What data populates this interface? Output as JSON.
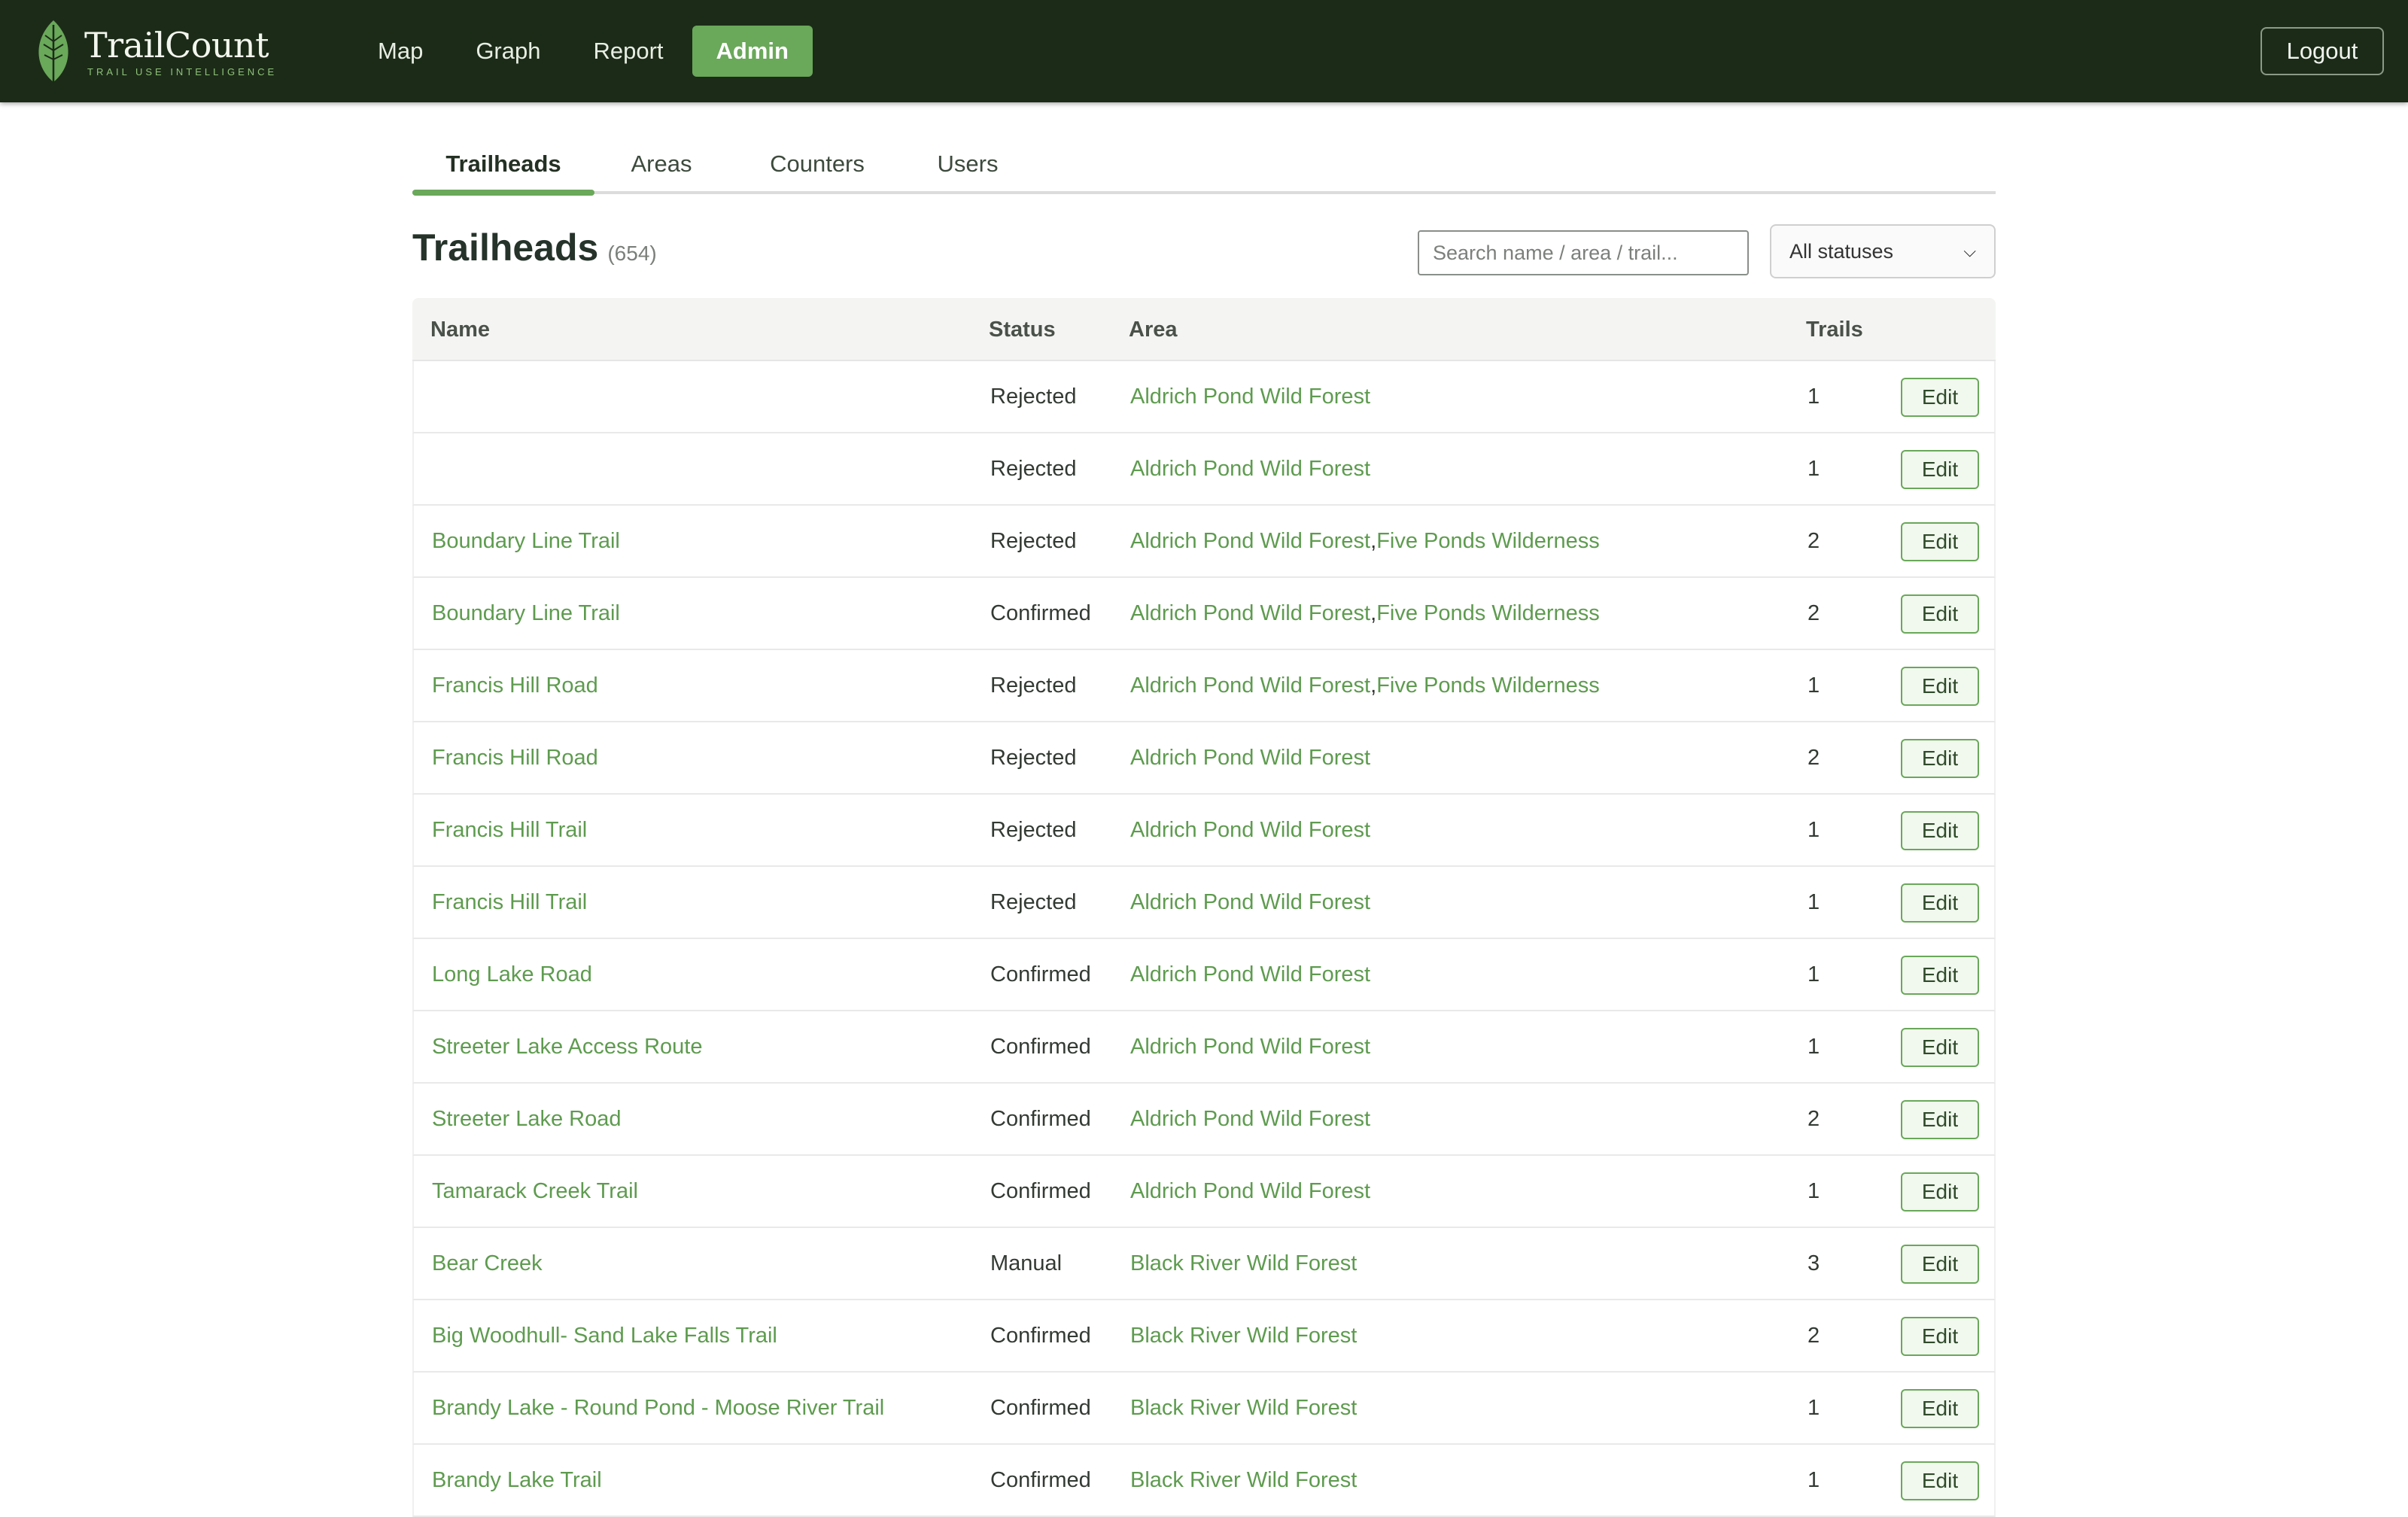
{
  "brand": {
    "name": "TrailCount",
    "tagline": "TRAIL USE INTELLIGENCE"
  },
  "nav": {
    "items": [
      {
        "label": "Map",
        "active": false
      },
      {
        "label": "Graph",
        "active": false
      },
      {
        "label": "Report",
        "active": false
      },
      {
        "label": "Admin",
        "active": true
      }
    ],
    "logout_label": "Logout"
  },
  "subtabs": [
    {
      "label": "Trailheads",
      "active": true
    },
    {
      "label": "Areas",
      "active": false
    },
    {
      "label": "Counters",
      "active": false
    },
    {
      "label": "Users",
      "active": false
    }
  ],
  "page": {
    "title": "Trailheads",
    "count": "(654)",
    "search_placeholder": "Search name / area / trail...",
    "status_filter": "All statuses"
  },
  "table": {
    "columns": [
      "Name",
      "Status",
      "Area",
      "Trails"
    ],
    "edit_label": "Edit",
    "rows": [
      {
        "name": "",
        "status": "Rejected",
        "areas": [
          "Aldrich Pond Wild Forest"
        ],
        "trails": "1"
      },
      {
        "name": "",
        "status": "Rejected",
        "areas": [
          "Aldrich Pond Wild Forest"
        ],
        "trails": "1"
      },
      {
        "name": "Boundary Line Trail",
        "status": "Rejected",
        "areas": [
          "Aldrich Pond Wild Forest",
          "Five Ponds Wilderness"
        ],
        "trails": "2"
      },
      {
        "name": "Boundary Line Trail",
        "status": "Confirmed",
        "areas": [
          "Aldrich Pond Wild Forest",
          "Five Ponds Wilderness"
        ],
        "trails": "2"
      },
      {
        "name": "Francis Hill Road",
        "status": "Rejected",
        "areas": [
          "Aldrich Pond Wild Forest",
          "Five Ponds Wilderness"
        ],
        "trails": "1"
      },
      {
        "name": "Francis Hill Road",
        "status": "Rejected",
        "areas": [
          "Aldrich Pond Wild Forest"
        ],
        "trails": "2"
      },
      {
        "name": "Francis Hill Trail",
        "status": "Rejected",
        "areas": [
          "Aldrich Pond Wild Forest"
        ],
        "trails": "1"
      },
      {
        "name": "Francis Hill Trail",
        "status": "Rejected",
        "areas": [
          "Aldrich Pond Wild Forest"
        ],
        "trails": "1"
      },
      {
        "name": "Long Lake Road",
        "status": "Confirmed",
        "areas": [
          "Aldrich Pond Wild Forest"
        ],
        "trails": "1"
      },
      {
        "name": "Streeter Lake Access Route",
        "status": "Confirmed",
        "areas": [
          "Aldrich Pond Wild Forest"
        ],
        "trails": "1"
      },
      {
        "name": "Streeter Lake Road",
        "status": "Confirmed",
        "areas": [
          "Aldrich Pond Wild Forest"
        ],
        "trails": "2"
      },
      {
        "name": "Tamarack Creek Trail",
        "status": "Confirmed",
        "areas": [
          "Aldrich Pond Wild Forest"
        ],
        "trails": "1"
      },
      {
        "name": "Bear Creek",
        "status": "Manual",
        "areas": [
          "Black River Wild Forest"
        ],
        "trails": "3"
      },
      {
        "name": "Big Woodhull- Sand Lake Falls Trail",
        "status": "Confirmed",
        "areas": [
          "Black River Wild Forest"
        ],
        "trails": "2"
      },
      {
        "name": "Brandy Lake - Round Pond - Moose River Trail",
        "status": "Confirmed",
        "areas": [
          "Black River Wild Forest"
        ],
        "trails": "1"
      },
      {
        "name": "Brandy Lake Trail",
        "status": "Confirmed",
        "areas": [
          "Black River Wild Forest"
        ],
        "trails": "1"
      }
    ]
  }
}
